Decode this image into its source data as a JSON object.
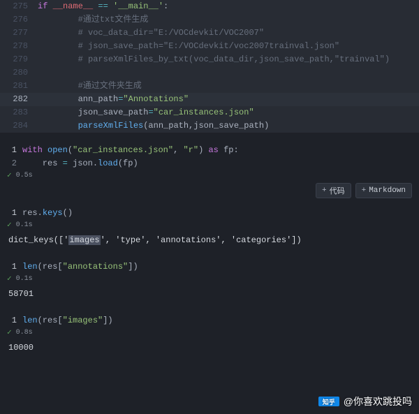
{
  "editor": {
    "lines": [
      {
        "n": 275,
        "indent": 0,
        "hl": false,
        "tokens": [
          {
            "c": "kw",
            "t": "if"
          },
          {
            "c": "pl",
            "t": " "
          },
          {
            "c": "var",
            "t": "__name__"
          },
          {
            "c": "pl",
            "t": " "
          },
          {
            "c": "op",
            "t": "=="
          },
          {
            "c": "pl",
            "t": " "
          },
          {
            "c": "str",
            "t": "'__main__'"
          },
          {
            "c": "pl",
            "t": ":"
          }
        ]
      },
      {
        "n": 276,
        "indent": 2,
        "hl": false,
        "tokens": [
          {
            "c": "cm",
            "t": "#通过txt文件生成"
          }
        ]
      },
      {
        "n": 277,
        "indent": 2,
        "hl": false,
        "tokens": [
          {
            "c": "cm",
            "t": "# voc_data_dir=\"E:/VOCdevkit/VOC2007\""
          }
        ]
      },
      {
        "n": 278,
        "indent": 2,
        "hl": false,
        "tokens": [
          {
            "c": "cm",
            "t": "# json_save_path=\"E:/VOCdevkit/voc2007trainval.json\""
          }
        ]
      },
      {
        "n": 279,
        "indent": 2,
        "hl": false,
        "tokens": [
          {
            "c": "cm",
            "t": "# parseXmlFiles_by_txt(voc_data_dir,json_save_path,\"trainval\")"
          }
        ]
      },
      {
        "n": 280,
        "indent": 0,
        "hl": false,
        "tokens": []
      },
      {
        "n": 281,
        "indent": 2,
        "hl": false,
        "tokens": [
          {
            "c": "cm",
            "t": "#通过文件夹生成"
          }
        ]
      },
      {
        "n": 282,
        "indent": 2,
        "hl": true,
        "tokens": [
          {
            "c": "pl",
            "t": "ann_path"
          },
          {
            "c": "op",
            "t": "="
          },
          {
            "c": "str",
            "t": "\"Annotations\""
          }
        ]
      },
      {
        "n": 283,
        "indent": 2,
        "hl": false,
        "tokens": [
          {
            "c": "pl",
            "t": "json_save_path"
          },
          {
            "c": "op",
            "t": "="
          },
          {
            "c": "str",
            "t": "\"car_instances.json\""
          }
        ]
      },
      {
        "n": 284,
        "indent": 2,
        "hl": false,
        "tokens": [
          {
            "c": "fn",
            "t": "parseXmlFiles"
          },
          {
            "c": "pl",
            "t": "(ann_path,json_save_path)"
          }
        ]
      }
    ]
  },
  "cells": [
    {
      "lines": [
        {
          "n": 1,
          "tokens": [
            {
              "c": "kw",
              "t": "with"
            },
            {
              "c": "pl",
              "t": " "
            },
            {
              "c": "fn",
              "t": "open"
            },
            {
              "c": "pl",
              "t": "("
            },
            {
              "c": "str",
              "t": "\"car_instances.json\""
            },
            {
              "c": "pl",
              "t": ", "
            },
            {
              "c": "str",
              "t": "\"r\""
            },
            {
              "c": "pl",
              "t": ") "
            },
            {
              "c": "kw",
              "t": "as"
            },
            {
              "c": "pl",
              "t": " fp:"
            }
          ]
        },
        {
          "n": 2,
          "tokens": [
            {
              "c": "pl",
              "t": "    res "
            },
            {
              "c": "op",
              "t": "="
            },
            {
              "c": "pl",
              "t": " json."
            },
            {
              "c": "fn",
              "t": "load"
            },
            {
              "c": "pl",
              "t": "(fp)"
            }
          ]
        }
      ],
      "time": "0.5s",
      "toolbar": true,
      "output_tokens": null
    },
    {
      "lines": [
        {
          "n": 1,
          "tokens": [
            {
              "c": "pl",
              "t": "res."
            },
            {
              "c": "fn",
              "t": "keys"
            },
            {
              "c": "pl",
              "t": "()"
            }
          ]
        }
      ],
      "time": "0.1s",
      "toolbar": false,
      "output_tokens": [
        {
          "c": "",
          "t": "dict_keys(['"
        },
        {
          "c": "hlbox",
          "t": "images"
        },
        {
          "c": "",
          "t": "', 'type', 'annotations', 'categories'])"
        }
      ]
    },
    {
      "lines": [
        {
          "n": 1,
          "tokens": [
            {
              "c": "fn",
              "t": "len"
            },
            {
              "c": "pl",
              "t": "(res["
            },
            {
              "c": "str",
              "t": "\"annotations\""
            },
            {
              "c": "pl",
              "t": "])"
            }
          ]
        }
      ],
      "time": "0.1s",
      "toolbar": false,
      "output_tokens": [
        {
          "c": "",
          "t": "58701"
        }
      ]
    },
    {
      "lines": [
        {
          "n": 1,
          "tokens": [
            {
              "c": "fn",
              "t": "len"
            },
            {
              "c": "pl",
              "t": "(res["
            },
            {
              "c": "str",
              "t": "\"images\""
            },
            {
              "c": "pl",
              "t": "])"
            }
          ]
        }
      ],
      "time": "0.8s",
      "toolbar": false,
      "output_tokens": [
        {
          "c": "",
          "t": "10000"
        }
      ]
    }
  ],
  "buttons": {
    "code": "代码",
    "markdown": "Markdown"
  },
  "watermark": {
    "logo": "知乎",
    "text": "@你喜欢跳投吗"
  }
}
